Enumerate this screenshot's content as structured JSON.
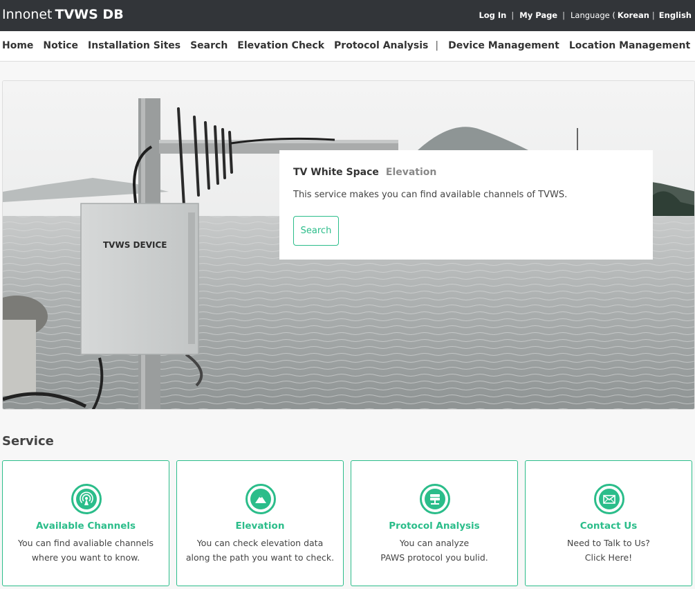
{
  "header": {
    "brand_light": "Innonet",
    "brand_bold": "TVWS DB",
    "login": "Log In",
    "mypage": "My Page",
    "language_label": "Language (",
    "korean": "Korean",
    "english": "English",
    "sep": "|"
  },
  "nav": {
    "items": [
      "Home",
      "Notice",
      "Installation Sites",
      "Search",
      "Elevation Check",
      "Protocol Analysis"
    ],
    "divider": "|",
    "items2": [
      "Device Management",
      "Location Management"
    ]
  },
  "hero": {
    "device_label": "TVWS DEVICE",
    "card": {
      "title": "TV White Space",
      "subtitle": "Elevation",
      "description": "This service makes you can find available channels of TVWS.",
      "button": "Search"
    }
  },
  "service": {
    "title": "Service",
    "cards": [
      {
        "name": "Available Channels",
        "line1": "You can find avaliable channels",
        "line2": "where you want to know.",
        "icon": "antenna-icon"
      },
      {
        "name": "Elevation",
        "line1": "You can check elevation data",
        "line2": "along the path you want to check.",
        "icon": "mountain-icon"
      },
      {
        "name": "Protocol Analysis",
        "line1": "You can analyze",
        "line2": "PAWS protocol you bulid.",
        "icon": "server-icon"
      },
      {
        "name": "Contact Us",
        "line1": "Need to Talk to Us?",
        "line2": "Click Here!",
        "icon": "envelope-icon"
      }
    ]
  },
  "colors": {
    "accent": "#2bbd8a",
    "topbar": "#323539"
  }
}
